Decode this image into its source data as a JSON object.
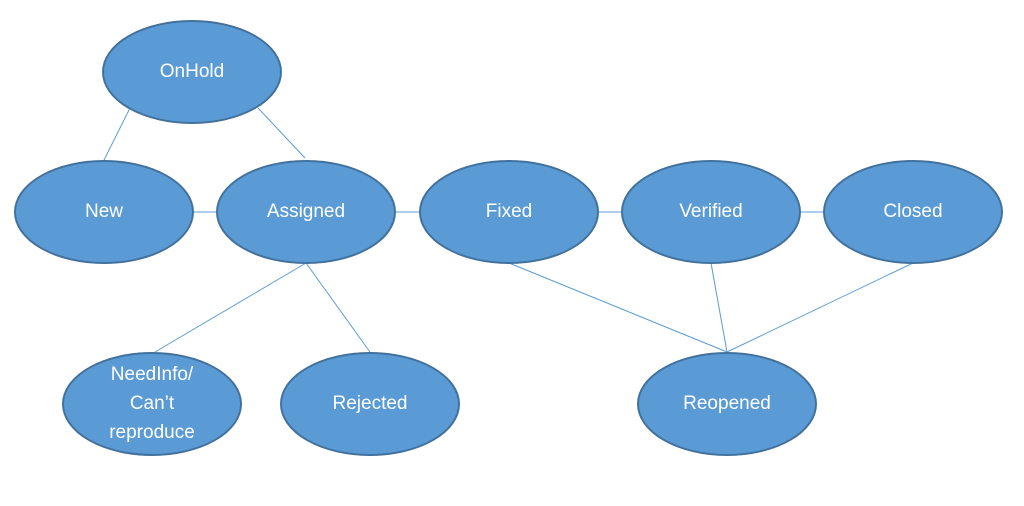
{
  "colors": {
    "fill": "#5b9bd5",
    "stroke": "#41719c",
    "edge": "#5b9bd5",
    "text": "#ffffff"
  },
  "nodes": [
    {
      "id": "onhold",
      "lines": [
        "OnHold"
      ]
    },
    {
      "id": "new",
      "lines": [
        "New"
      ]
    },
    {
      "id": "assigned",
      "lines": [
        "Assigned"
      ]
    },
    {
      "id": "fixed",
      "lines": [
        "Fixed"
      ]
    },
    {
      "id": "verified",
      "lines": [
        "Verified"
      ]
    },
    {
      "id": "closed",
      "lines": [
        "Closed"
      ]
    },
    {
      "id": "needinfo",
      "lines": [
        "NeedInfo/",
        "Can’t",
        "reproduce"
      ]
    },
    {
      "id": "rejected",
      "lines": [
        "Rejected"
      ]
    },
    {
      "id": "reopened",
      "lines": [
        "Reopened"
      ]
    }
  ],
  "edges": [
    [
      "onhold",
      "new"
    ],
    [
      "onhold",
      "assigned"
    ],
    [
      "new",
      "assigned"
    ],
    [
      "assigned",
      "fixed"
    ],
    [
      "fixed",
      "verified"
    ],
    [
      "verified",
      "closed"
    ],
    [
      "assigned",
      "needinfo"
    ],
    [
      "assigned",
      "rejected"
    ],
    [
      "fixed",
      "reopened"
    ],
    [
      "verified",
      "reopened"
    ],
    [
      "closed",
      "reopened"
    ]
  ]
}
